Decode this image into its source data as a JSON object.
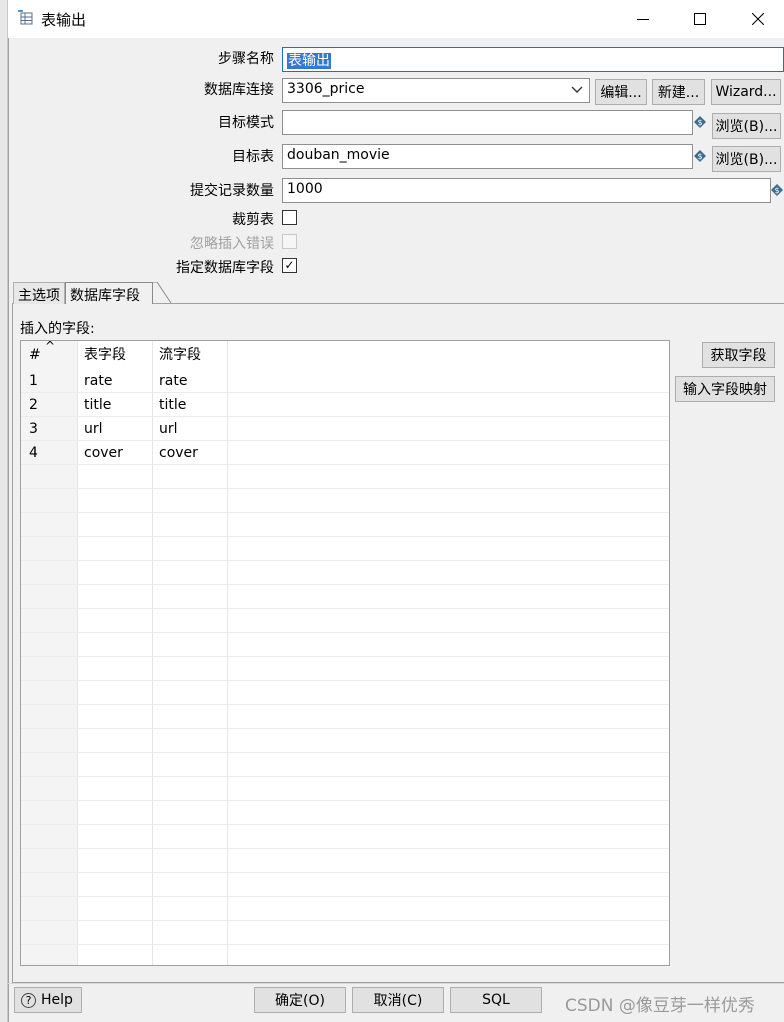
{
  "window": {
    "title": "表输出",
    "minimize_icon": "minimize-icon",
    "maximize_icon": "maximize-icon",
    "close_icon": "close-icon"
  },
  "form": {
    "step_name": {
      "label": "步骤名称",
      "value": "表输出"
    },
    "db_connection": {
      "label": "数据库连接",
      "value": "3306_price",
      "edit_label": "编辑...",
      "new_label": "新建...",
      "wizard_label": "Wizard..."
    },
    "target_schema": {
      "label": "目标模式",
      "value": "",
      "browse_label": "浏览(B)..."
    },
    "target_table": {
      "label": "目标表",
      "value": "douban_movie",
      "browse_label": "浏览(B)..."
    },
    "commit_size": {
      "label": "提交记录数量",
      "value": "1000"
    },
    "truncate_table": {
      "label": "裁剪表",
      "checked": false
    },
    "ignore_insert_errors": {
      "label": "忽略插入错误",
      "checked": false,
      "disabled": true
    },
    "specify_db_fields": {
      "label": "指定数据库字段",
      "checked": true,
      "check_glyph": "✓"
    }
  },
  "tabs": [
    {
      "label": "主选项",
      "active": false
    },
    {
      "label": "数据库字段",
      "active": true
    }
  ],
  "fields_panel": {
    "label": "插入的字段:",
    "columns": [
      "#",
      "表字段",
      "流字段"
    ],
    "sort_indicator": "^",
    "rows": [
      {
        "num": "1",
        "table_field": "rate",
        "stream_field": "rate"
      },
      {
        "num": "2",
        "table_field": "title",
        "stream_field": "title"
      },
      {
        "num": "3",
        "table_field": "url",
        "stream_field": "url"
      },
      {
        "num": "4",
        "table_field": "cover",
        "stream_field": "cover"
      }
    ],
    "get_fields_label": "获取字段",
    "map_fields_label": "输入字段映射"
  },
  "footer": {
    "help_label": "Help",
    "ok_label": "确定(O)",
    "cancel_label": "取消(C)",
    "sql_label": "SQL"
  },
  "watermark": "CSDN @像豆芽一样优秀",
  "colors": {
    "accent": "#3478d0",
    "focus_border": "#1a72c6",
    "window_bg": "#f0f0f0",
    "button_bg": "#e1e1e1"
  }
}
